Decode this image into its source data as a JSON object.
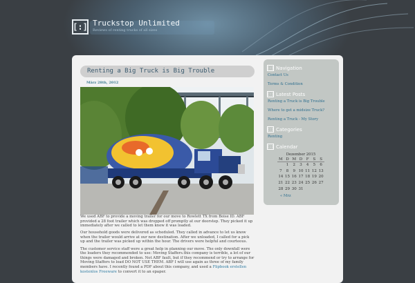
{
  "header": {
    "logo_text": "[:]",
    "site_title": "Truckstop Unlimited",
    "tagline": "Reviews of renting trucks of all sizes"
  },
  "post": {
    "title": "Renting a Big Truck is Big Trouble",
    "date": "März 28th, 2012",
    "paragraphs": [
      "We used ABF to provide a moving trailer for our move to Rowlett TX from Boise ID. ABF provided a 28 foot trailer which was dropped off promptly at our doorstep. They picked it up immediately after we called to let them know it was loaded.",
      "Our household goods were delivered as scheduled. They called in advance to let us know when the trailer would arrive at our new destination. After we unloaded, I called for a pick up and the trailer was picked up within the hour. The drivers were helpful and courteous.",
      "The customer service staff were a great help in planning our move. The only downfall were the loaders they recommended to use: Moving Staffers.this company is terrible, a lot of our things were damaged and broken. Not ABF fault, but if they recommend or try to arrange for Moving Staffers to load DO NOT USE THEM. ABF I will use again as three of my family members have. I recently found a PDF about this company, and used a"
    ],
    "link_text": "Flipbook erstellen kostenlos Freeware",
    "tail_text": " to convert it to an epaper."
  },
  "sidebar": {
    "icon_text": "[:]",
    "navigation": {
      "heading": "Navigation",
      "items": [
        "Contact Us",
        "Terms & Condition"
      ]
    },
    "latest_posts": {
      "heading": "Latest Posts",
      "items": [
        "Renting a Truck is Big Trouble",
        "Where to get a midsize Truck?",
        "Renting a Truck - My Story"
      ]
    },
    "categories": {
      "heading": "Categories",
      "items": [
        "Renting"
      ]
    },
    "calendar": {
      "heading": "Calendar",
      "caption": "Dezember 2015",
      "weekdays": [
        "M",
        "D",
        "M",
        "D",
        "F",
        "S",
        "S"
      ],
      "weeks": [
        [
          "",
          "1",
          "2",
          "3",
          "4",
          "5",
          "6"
        ],
        [
          "7",
          "8",
          "9",
          "10",
          "11",
          "12",
          "13"
        ],
        [
          "14",
          "15",
          "16",
          "17",
          "18",
          "19",
          "20"
        ],
        [
          "21",
          "22",
          "23",
          "24",
          "25",
          "26",
          "27"
        ],
        [
          "28",
          "29",
          "30",
          "31",
          "",
          "",
          ""
        ]
      ],
      "prev_link": "« Mrz"
    }
  }
}
